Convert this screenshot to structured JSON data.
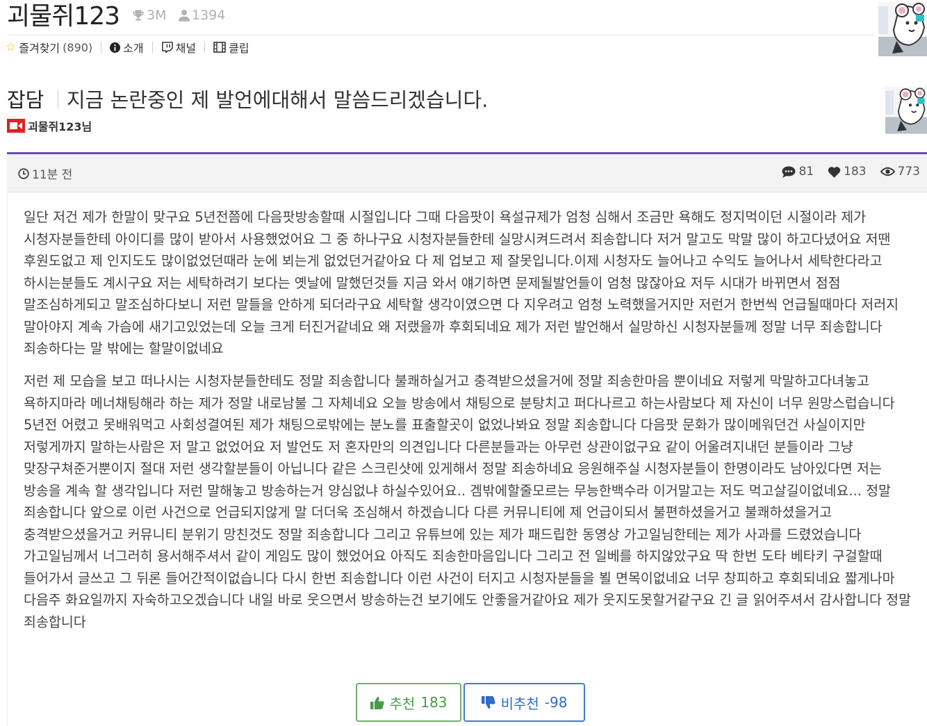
{
  "header": {
    "channel_name": "괴물쥐123",
    "trophy": "3M",
    "members": "1394",
    "nav": [
      {
        "label": "즐겨찾기",
        "count": "(890)"
      },
      {
        "label": "소개"
      },
      {
        "label": "채널"
      },
      {
        "label": "클립"
      }
    ]
  },
  "post": {
    "category": "잡담",
    "title": "지금 논란중인 제 발언에대해서 말씀드리겠습니다.",
    "author": "괴물쥐123님",
    "time": "11분 전",
    "comments": "81",
    "likes": "183",
    "views": "773",
    "paragraphs": [
      "일단 저건 제가 한말이 맞구요 5년전쯤에 다음팟방송할때 시절입니다 그때 다음팟이 욕설규제가 엄청 심해서 조금만 욕해도 정지먹이던 시절이라 제가 시청자분들한테 아이디를 많이 받아서 사용했었어요 그 중 하나구요 시청자분들한테 실망시켜드려서 죄송합니다 저거 말고도 막말 많이 하고다녔어요 저땐 후원도없고 제 인지도도 많이없었던때라 눈에 뵈는게 없었던거같아요 다 제 업보고 제 잘못입니다.이제 시청자도 늘어나고 수익도 늘어나서 세탁한다라고 하시는분들도 계시구요 저는 세탁하려기 보다는 옛날에 말했던것들 지금 와서 얘기하면 문제될발언들이 엄청 많잖아요 저두 시대가 바뀌면서 점점 말조심하게되고 말조심하다보니 저런 말들을 안하게 되더라구요 세탁할 생각이였으면 다 지우려고 엄청 노력했을거지만 저런거 한번씩 언급될때마다 저러지 말아야지 계속 가슴에 새기고있었는데 오늘 크게 터진거같네요 왜 저랬을까 후회되네요 제가 저런 발언해서 실망하신 시청자분들께 정말 너무 죄송합니다 죄송하다는 말 밖에는 할말이없네요",
      "저런 제 모습을 보고 떠나시는 시청자분들한테도 정말 죄송합니다 불쾌하실거고 충격받으셨을거에 정말 죄송한마음 뿐이네요 저렇게 막말하고다녀놓고 욕하지마라 메너채팅해라 하는 제가 정말 내로남불 그 자체네요 오늘 방송에서 채팅으로 분탕치고 퍼다나르고 하는사람보다 제 자신이 너무 원망스럽습니다 5년전 어렸고 못배워먹고 사회성결여된 제가 채팅으로밖에는 분노를 표출할곳이 없었나봐요 정말 죄송합니다 다음팟 문화가 많이메워던건 사실이지만 저렇게까지 말하는사람은 저 말고 없었어요 저 발언도 저 혼자만의 의견입니다 다른분들과는 아무런 상관이없구요 같이 어울려지내던 분들이라 그냥 맞장구쳐준거뿐이지 절대 저런 생각할분들이 아닙니다 같은 스크린샷에 있게해서 정말 죄송하네요 응원해주실 시청자분들이 한명이라도 남아있다면 저는 방송을 계속 할 생각입니다 저런 말해놓고 방송하는거 양심없냐 하실수있어요.. 겜밖에할줄모르는 무능한백수라 이거말고는 저도 먹고살길이없네요... 정말 죄송합니다 앞으로 이런 사건으로 언급되지않게 말 더더욱 조심해서 하겠습니다 다른 커뮤니티에 제 언급이되서 불편하셨을거고 불쾌하셨을거고 충격받으셨을거고 커뮤니티 분위기 망친것도 정말 죄송합니다 그리고 유튜브에 있는 제가 패드립한 동영상 가고일님한테는 제가 사과를 드렸었습니다 가고일님께서 너그러히 용서해주셔서 같이 게임도 많이 했었어요 아직도 죄송한마음입니다 그리고 전 일베를  하지않았구요 딱 한번 도타 베타키 구걸할때 들어가서 글쓰고 그 뒤론 들어간적이없습니다 다시 한번 죄송합니다 이런 사건이 터지고 시청자분들을 뵐 면목이없네요 너무 창피하고 후회되네요 짧게나마 다음주 화요일까지 자숙하고오겠습니다 내일 바로 웃으면서 방송하는건 보기에도 안좋을거같아요 제가 웃지도못할거같구요 긴 글 읽어주셔서 감사합니다 정말 죄송합니다"
    ]
  },
  "votes": {
    "up_label": "추천",
    "up_count": "183",
    "down_label": "비추천",
    "down_count": "-98"
  },
  "colors": {
    "accent_purple": "#6c4ab6",
    "upvote_green": "#6cb26c",
    "downvote_blue": "#3d7bd6",
    "star_yellow": "#f0b400",
    "live_red": "#e02020"
  }
}
